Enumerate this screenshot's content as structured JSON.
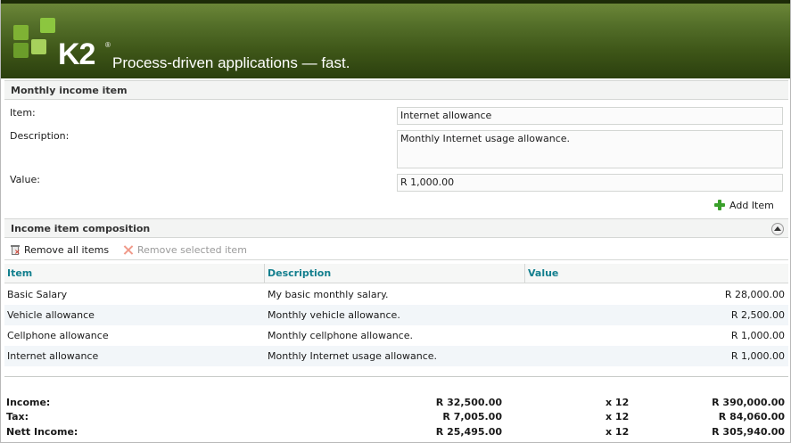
{
  "header": {
    "logo_text": "K2",
    "logo_mark": "®",
    "tagline": "Process-driven applications — fast."
  },
  "item_section": {
    "title": "Monthly income item",
    "item_label": "Item:",
    "item_value": "Internet allowance",
    "description_label": "Description:",
    "description_value": "Monthly Internet usage allowance.",
    "value_label": "Value:",
    "value_value": "R 1,000.00",
    "add_item_label": "Add Item",
    "add_item_icon": "plus-icon"
  },
  "composition_section": {
    "title": "Income item composition",
    "collapse_icon": "collapse-up-icon",
    "toolbar": {
      "remove_all_label": "Remove all items",
      "remove_all_icon": "trash-icon",
      "remove_selected_label": "Remove selected item",
      "remove_selected_icon": "close-icon"
    },
    "columns": [
      "Item",
      "Description",
      "Value"
    ],
    "rows": [
      {
        "item": "Basic Salary",
        "description": "My basic monthly salary.",
        "value": "R 28,000.00"
      },
      {
        "item": "Vehicle allowance",
        "description": "Monthly vehicle allowance.",
        "value": "R 2,500.00"
      },
      {
        "item": "Cellphone allowance",
        "description": "Monthly cellphone allowance.",
        "value": "R 1,000.00"
      },
      {
        "item": "Internet allowance",
        "description": "Monthly Internet usage allowance.",
        "value": "R 1,000.00"
      }
    ]
  },
  "totals": [
    {
      "label": "Income:",
      "monthly": "R 32,500.00",
      "multiplier": "x 12",
      "annual": "R 390,000.00"
    },
    {
      "label": "Tax:",
      "monthly": "R 7,005.00",
      "multiplier": "x 12",
      "annual": "R 84,060.00"
    },
    {
      "label": "Nett Income:",
      "monthly": "R 25,495.00",
      "multiplier": "x 12",
      "annual": "R 305,940.00"
    }
  ],
  "colors": {
    "banner_green": "#3e5618",
    "logo_green": "#8cc63f",
    "column_header_teal": "#137f8e",
    "alt_row": "#f2f6f9",
    "add_green": "#3aa02b"
  }
}
